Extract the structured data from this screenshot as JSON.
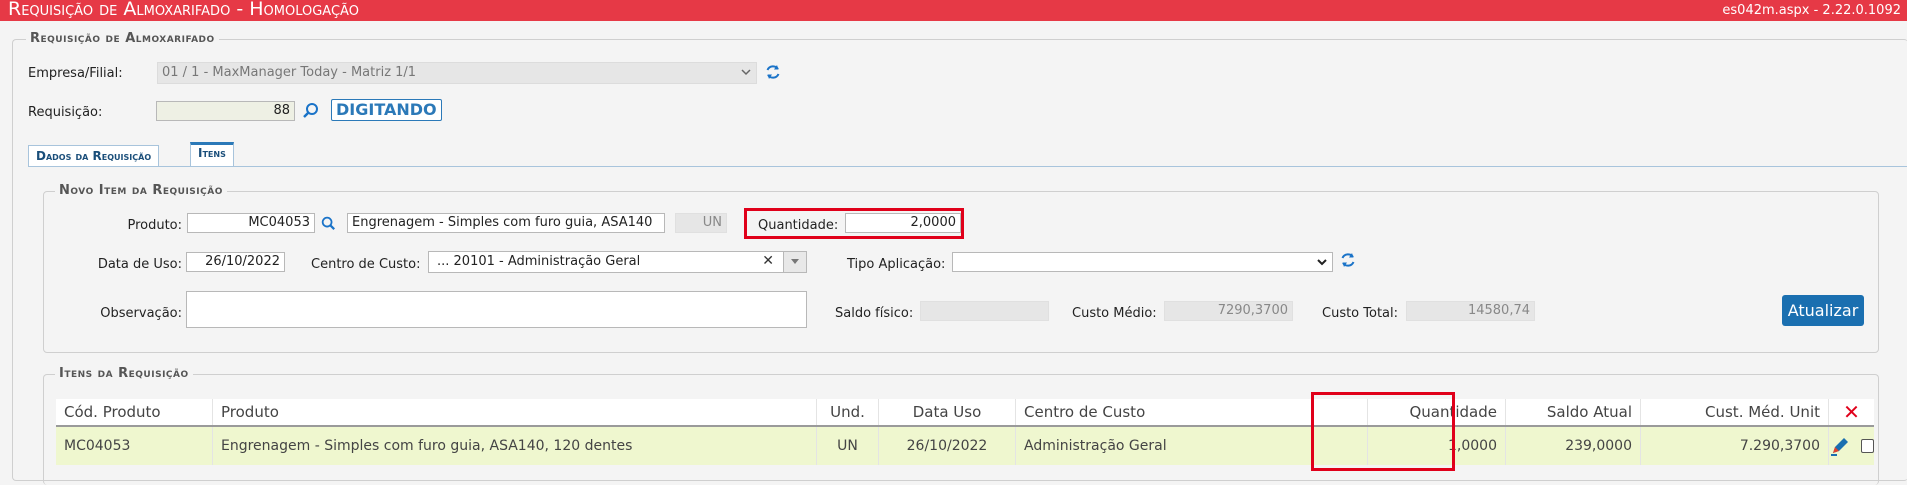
{
  "header": {
    "title": "Requisição de Almoxarifado  - Homologação",
    "version": "es042m.aspx - 2.22.0.1092"
  },
  "requisicao_group": {
    "legend": "Requisição de Almoxarifado",
    "empresa_label": "Empresa/Filial:",
    "empresa_value": "01 / 1 - MaxManager Today - Matriz 1/1",
    "requisicao_label": "Requisição:",
    "requisicao_value": "88",
    "status": "DIGITANDO"
  },
  "tabs": [
    {
      "label": "Dados da Requisição",
      "active": false
    },
    {
      "label": "Itens",
      "active": true
    }
  ],
  "novo_item": {
    "legend": "Novo Item da Requisição",
    "produto_label": "Produto:",
    "produto_code": "MC04053",
    "produto_desc": "Engrenagem - Simples com furo guia, ASA140",
    "unidade": "UN",
    "quantidade_label": "Quantidade:",
    "quantidade_value": "2,0000",
    "data_uso_label": "Data de Uso:",
    "data_uso_value": "26/10/2022",
    "centro_label": "Centro de Custo:",
    "centro_value": "... 20101 - Administração Geral",
    "tipo_aplicacao_label": "Tipo Aplicação:",
    "tipo_aplicacao_value": "",
    "observacao_label": "Observação:",
    "observacao_value": "",
    "saldo_fisico_label": "Saldo físico:",
    "saldo_fisico_value": "",
    "custo_medio_label": "Custo Médio:",
    "custo_medio_value": "7290,3700",
    "custo_total_label": "Custo Total:",
    "custo_total_value": "14580,74",
    "atualizar_label": "Atualizar"
  },
  "itens": {
    "legend": "Itens da Requisição",
    "columns": [
      "Cód. Produto",
      "Produto",
      "Und.",
      "Data Uso",
      "Centro de Custo",
      "Quantidade",
      "Saldo Atual",
      "Cust. Méd. Unit"
    ],
    "rows": [
      {
        "codigo": "MC04053",
        "produto": "Engrenagem - Simples com furo guia, ASA140, 120 dentes",
        "und": "UN",
        "data_uso": "26/10/2022",
        "centro": "Administração Geral",
        "quantidade": "1,0000",
        "saldo_atual": "239,0000",
        "custo_medio": "7.290,3700"
      }
    ]
  },
  "colors": {
    "header_bg": "#e63946",
    "accent_blue": "#1a6fb0",
    "row_highlight": "#eff7cf",
    "annotation_red": "#e0001a"
  },
  "icons": [
    "refresh-icon",
    "search-icon",
    "chevron-down-icon",
    "clear-icon",
    "edit-icon",
    "delete-icon"
  ]
}
